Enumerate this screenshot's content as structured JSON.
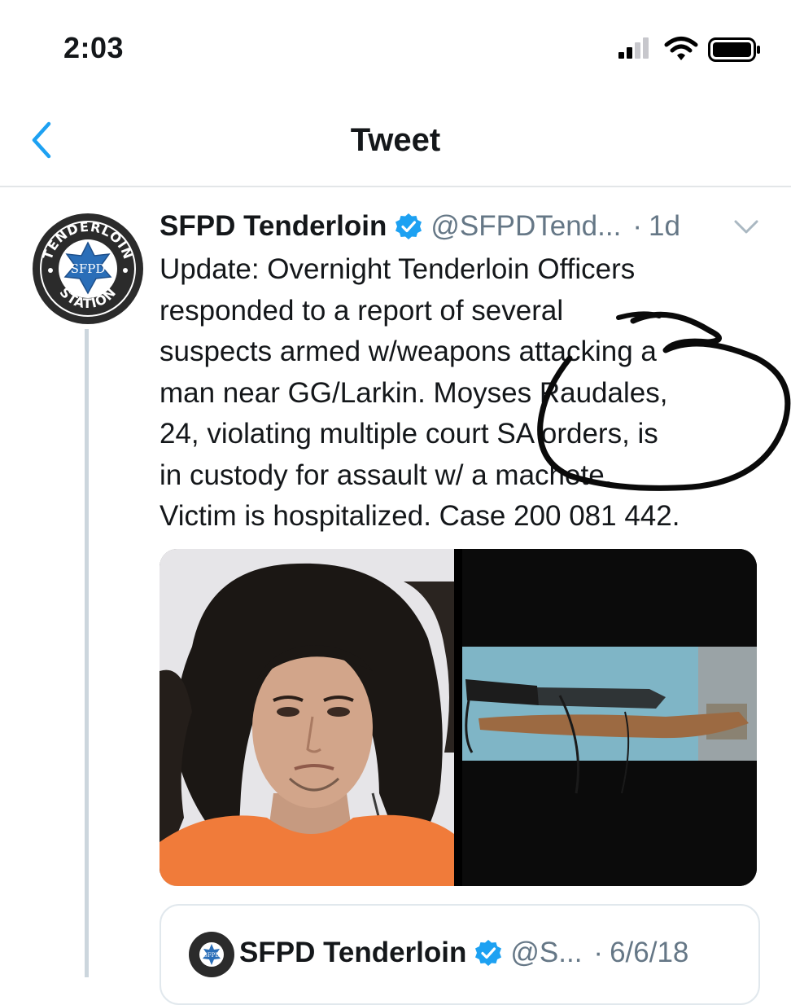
{
  "status_bar": {
    "time": "2:03",
    "icons": [
      "signal-icon",
      "wifi-icon",
      "battery-icon"
    ]
  },
  "nav": {
    "title": "Tweet",
    "back_icon": "chevron-left-icon"
  },
  "tweet": {
    "avatar_text_top": "TENDERLOIN",
    "avatar_badge": "SFPD",
    "avatar_text_bottom": "STATION",
    "author_name": "SFPD Tenderloin",
    "handle": "@SFPDTend...",
    "dot": "·",
    "time": "1d",
    "text_lines": [
      "Update: Overnight Tenderloin Officers",
      "responded to a report of several",
      "suspects armed w/weapons attacking a",
      "man near GG/Larkin.  Moyses Raudales,",
      "24, violating multiple court SA orders, is",
      "in custody for assault w/ a machete.",
      "Victim is hospitalized. Case 200 081 442."
    ]
  },
  "quote": {
    "avatar_badge": "SFPD",
    "author_name": "SFPD Tenderloin",
    "handle": "@S...",
    "dot": "·",
    "date": "6/6/18"
  },
  "colors": {
    "accent": "#1da1f2",
    "muted": "#657786",
    "divider": "#e3e6e8",
    "thread_line": "#ccd6dd",
    "shirt": "#f07b3a",
    "annotation": "#0a0a0a"
  }
}
